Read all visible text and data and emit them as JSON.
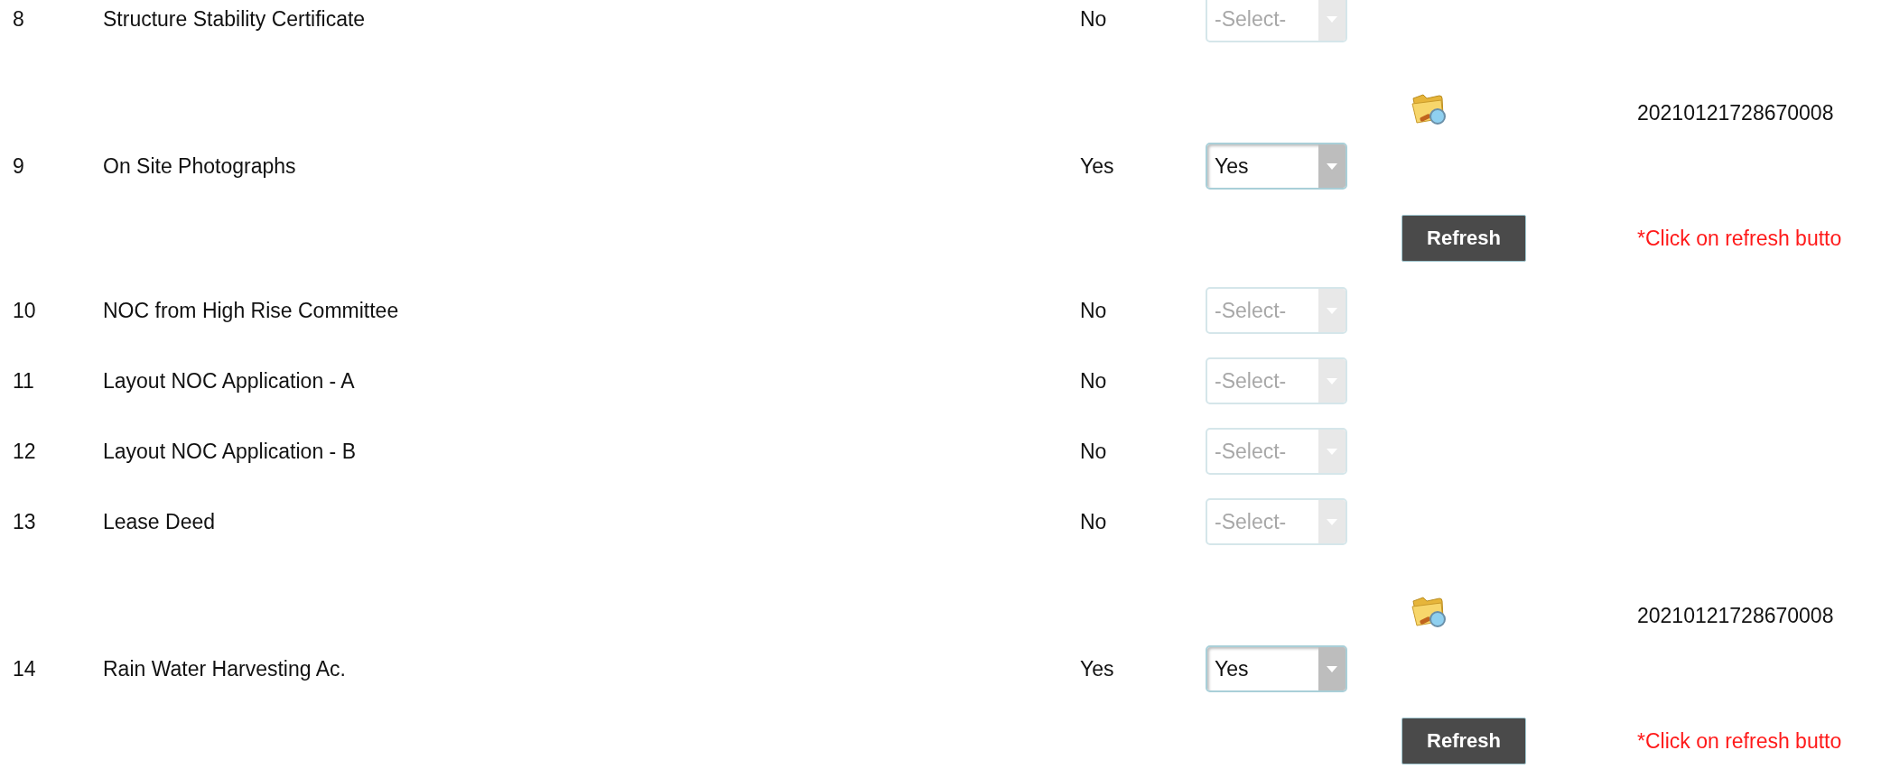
{
  "rows": [
    {
      "kind": "plain",
      "no": "8",
      "name": "Structure Stability Certificate",
      "answer": "No",
      "select": {
        "value": "-Select-",
        "disabled": true
      }
    },
    {
      "kind": "upload",
      "no": "9",
      "name": "On Site Photographs",
      "answer": "Yes",
      "select": {
        "value": "Yes",
        "disabled": false
      },
      "file_id": "20210121728670008",
      "button": "Refresh",
      "note": "*Click on refresh butto"
    },
    {
      "kind": "plain",
      "no": "10",
      "name": "NOC from High Rise Committee",
      "answer": "No",
      "select": {
        "value": "-Select-",
        "disabled": true
      }
    },
    {
      "kind": "plain",
      "no": "11",
      "name": "Layout NOC Application - A",
      "answer": "No",
      "select": {
        "value": "-Select-",
        "disabled": true
      }
    },
    {
      "kind": "plain",
      "no": "12",
      "name": "Layout NOC Application - B",
      "answer": "No",
      "select": {
        "value": "-Select-",
        "disabled": true
      }
    },
    {
      "kind": "plain",
      "no": "13",
      "name": "Lease Deed",
      "answer": "No",
      "select": {
        "value": "-Select-",
        "disabled": true
      }
    },
    {
      "kind": "upload",
      "no": "14",
      "name": "Rain Water Harvesting Ac.",
      "answer": "Yes",
      "select": {
        "value": "Yes",
        "disabled": false
      },
      "file_id": "20210121728670008",
      "button": "Refresh",
      "note": "*Click on refresh butto"
    }
  ]
}
